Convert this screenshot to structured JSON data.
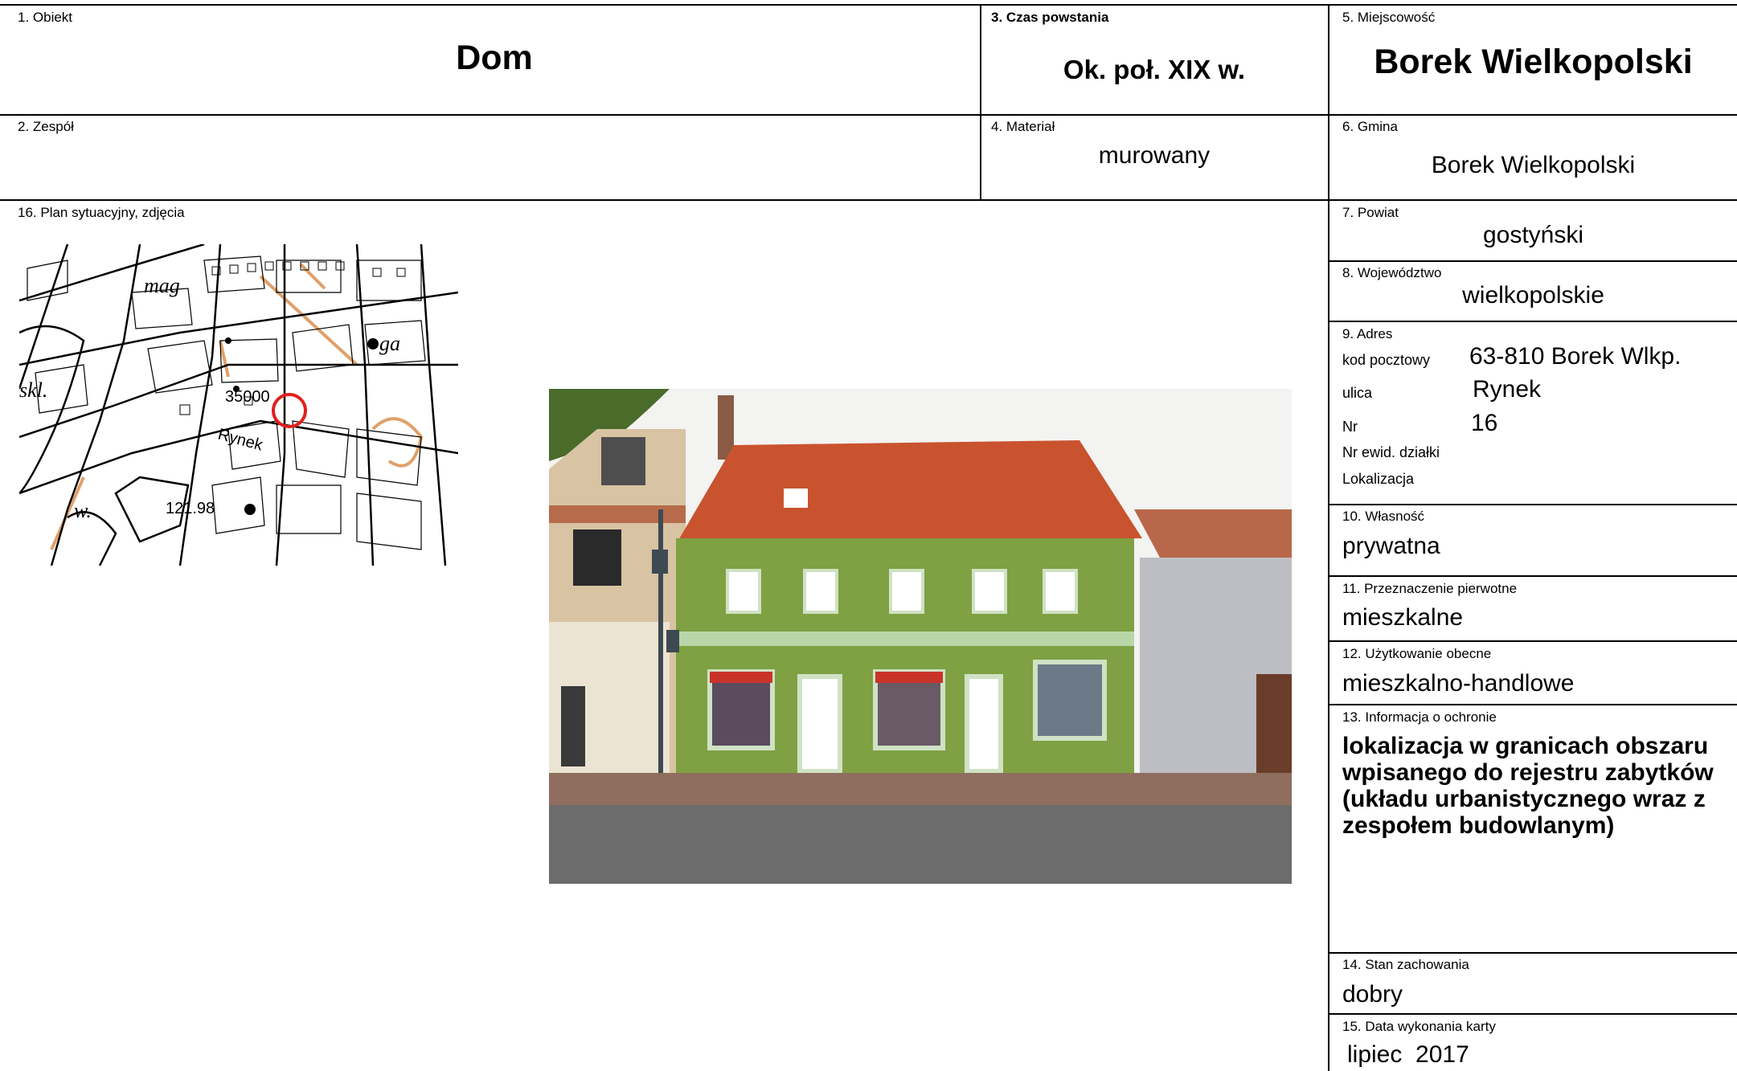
{
  "card": {
    "obiekt": {
      "label": "1. Obiekt",
      "value": "Dom"
    },
    "zespol": {
      "label": "2. Zespół",
      "value": ""
    },
    "czas": {
      "label": "3. Czas powstania",
      "value": "Ok. poł. XIX w."
    },
    "material": {
      "label": "4. Materiał",
      "value": "murowany"
    },
    "miejscowosc": {
      "label": "5. Miejscowość",
      "value": "Borek Wielkopolski"
    },
    "gmina": {
      "label": "6. Gmina",
      "value": "Borek Wielkopolski"
    },
    "powiat": {
      "label": "7. Powiat",
      "value": "gostyński"
    },
    "wojewodztwo": {
      "label": "8. Województwo",
      "value": "wielkopolskie"
    },
    "adres": {
      "label": "9. Adres",
      "kod_label": "kod pocztowy",
      "kod_value": "63-810 Borek Wlkp.",
      "ulica_label": "ulica",
      "ulica_value": "Rynek",
      "nr_label": "Nr",
      "nr_value": "16",
      "dzialka_label": "Nr ewid. działki",
      "lokalizacja_label": "Lokalizacja"
    },
    "wlasnosc": {
      "label": "10. Własność",
      "value": "prywatna"
    },
    "przeznaczenie": {
      "label": "11. Przeznaczenie pierwotne",
      "value": "mieszkalne"
    },
    "uzytkowanie": {
      "label": "12. Użytkowanie obecne",
      "value": "mieszkalno-handlowe"
    },
    "ochrona": {
      "label": "13. Informacja o ochronie",
      "value": "lokalizacja w granicach obszaru wpisanego do rejestru zabytków (układu urbanistycznego wraz z zespołem budowlanym)"
    },
    "stan": {
      "label": "14. Stan zachowania",
      "value": "dobry"
    },
    "data": {
      "label": "15. Data wykonania karty",
      "value": "lipiec  2017"
    },
    "plan": {
      "label": "16. Plan sytuacyjny, zdjęcia",
      "map_texts": {
        "mag": "mag",
        "ga": "ga",
        "skl": "skl.",
        "number": "35000",
        "street": "Rynek",
        "elevation": "121.98",
        "w": "w."
      }
    }
  },
  "colors": {
    "border": "#000000",
    "marker": "#e0201c",
    "facade": "#7fa043",
    "roof": "#c9532e",
    "sky": "#f3f3f1",
    "street": "#6c6c6c"
  }
}
